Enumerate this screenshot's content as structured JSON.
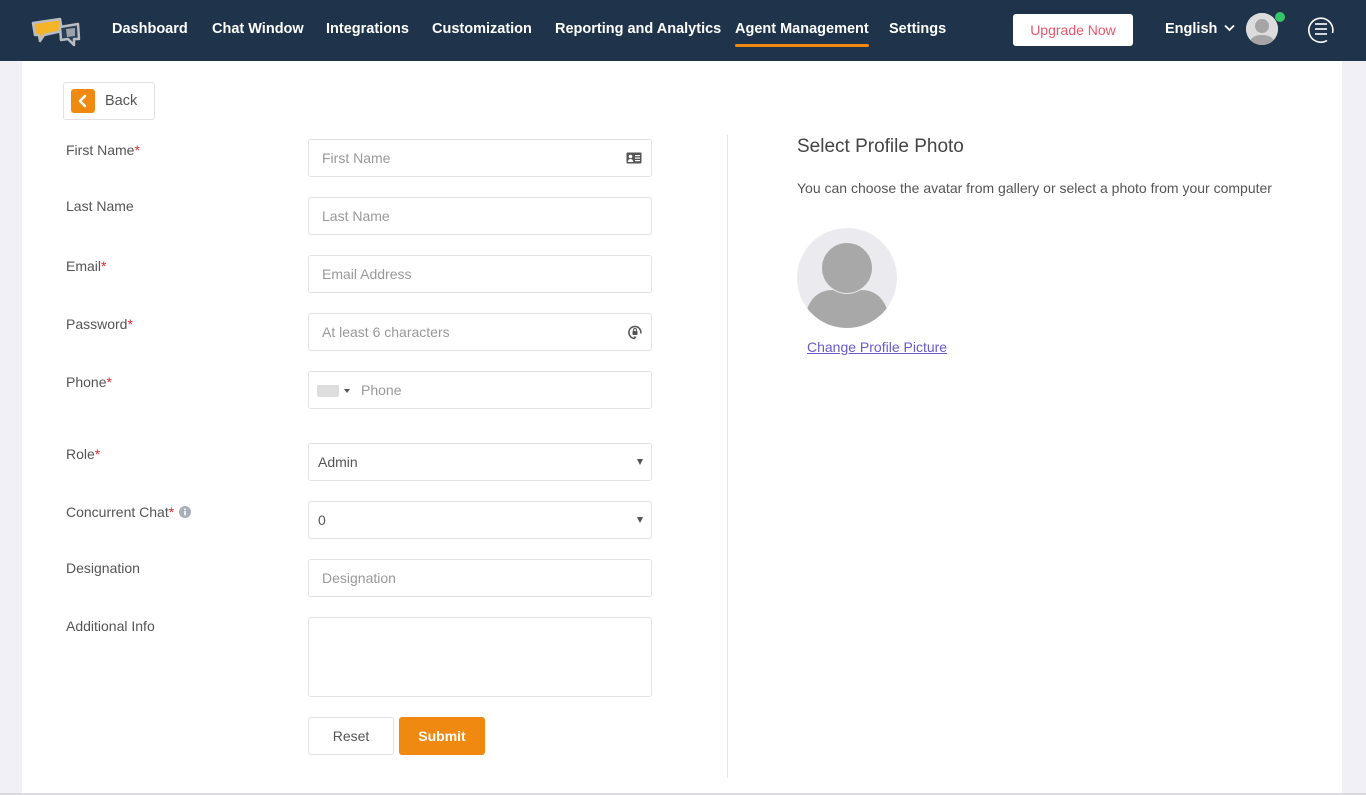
{
  "nav": {
    "logo": "chat-bubbles-logo",
    "items": [
      {
        "label": "Dashboard",
        "active": false
      },
      {
        "label": "Chat Window",
        "active": false
      },
      {
        "label": "Integrations",
        "active": false
      },
      {
        "label": "Customization",
        "active": false
      },
      {
        "label": "Reporting and Analytics",
        "active": false
      },
      {
        "label": "Agent Management",
        "active": true
      },
      {
        "label": "Settings",
        "active": false
      }
    ],
    "upgrade_label": "Upgrade Now",
    "language": "English",
    "user_status": "online",
    "accent_color": "#f0890f",
    "status_color": "#35c468"
  },
  "back_label": "Back",
  "form": {
    "first_name": {
      "label": "First Name",
      "required": "*",
      "placeholder": "First Name",
      "icon": "contact-card-icon"
    },
    "last_name": {
      "label": "Last Name",
      "placeholder": "Last Name"
    },
    "email": {
      "label": "Email",
      "required": "*",
      "placeholder": "Email Address"
    },
    "password": {
      "label": "Password",
      "required": "*",
      "placeholder": "At least 6 characters",
      "icon": "password-generate-icon"
    },
    "phone": {
      "label": "Phone",
      "required": "*",
      "placeholder": "Phone"
    },
    "role": {
      "label": "Role",
      "required": "*",
      "value": "Admin"
    },
    "concurrent_chat": {
      "label": "Concurrent Chat",
      "required": "*",
      "value": "0",
      "icon": "info-icon"
    },
    "designation": {
      "label": "Designation",
      "placeholder": "Designation"
    },
    "additional_info": {
      "label": "Additional Info",
      "placeholder": ""
    },
    "reset_label": "Reset",
    "submit_label": "Submit"
  },
  "profile_photo": {
    "title": "Select Profile Photo",
    "description": "You can choose the avatar from gallery or select a photo from your computer",
    "change_link": "Change Profile Picture"
  }
}
